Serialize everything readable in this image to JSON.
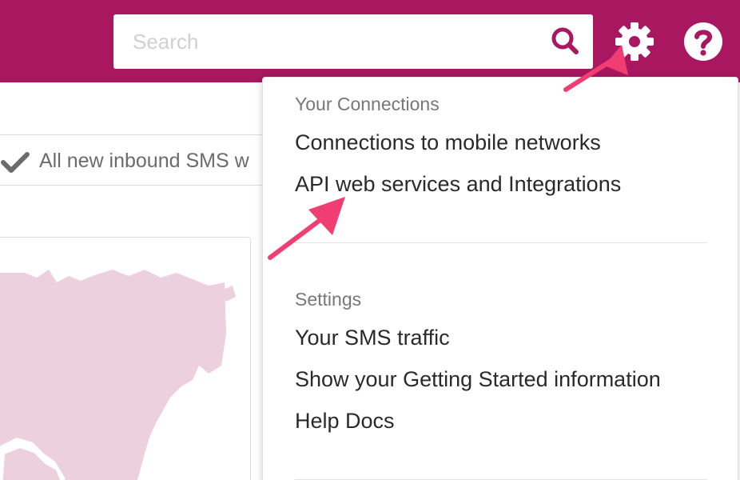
{
  "header": {
    "search": {
      "placeholder": "Search",
      "value": ""
    },
    "icons": {
      "search": "search-icon",
      "settings": "gear-icon",
      "help": "help-icon"
    },
    "colors": {
      "brand": "#a8175f",
      "annotation_arrow": "#f03e72",
      "map_fill": "#edd0de"
    }
  },
  "notice": {
    "icon": "checkmark-icon",
    "text": "All new inbound SMS w"
  },
  "dropdown": {
    "sections": [
      {
        "heading": "Your Connections",
        "items": [
          "Connections to mobile networks",
          "API web services and Integrations"
        ]
      },
      {
        "heading": "Settings",
        "items": [
          "Your SMS traffic",
          "Show your Getting Started information",
          "Help Docs"
        ]
      }
    ]
  }
}
